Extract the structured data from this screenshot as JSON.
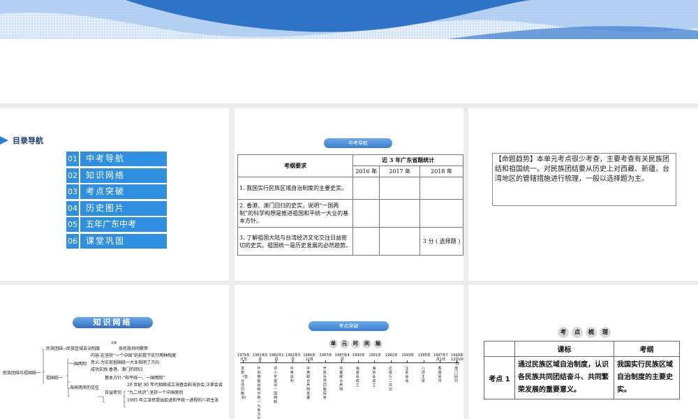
{
  "menu": {
    "header": "目录导航",
    "items": [
      {
        "num": "01",
        "label": "中考导航"
      },
      {
        "num": "02",
        "label": "知识网络"
      },
      {
        "num": "03",
        "label": "考点突破"
      },
      {
        "num": "04",
        "label": "历史图片"
      },
      {
        "num": "05",
        "label": "五年广东中考"
      },
      {
        "num": "06",
        "label": "课堂巩固"
      }
    ]
  },
  "exam_nav": {
    "pill": "中考导航",
    "col_requirement": "考纲要求",
    "col_stats": "近 3 年广东省题统计",
    "years": [
      "2016 年",
      "2017 年",
      "2018 年"
    ],
    "rows": [
      {
        "req": "1. 我国实行民族区域自治制度的主要史实。",
        "y2016": "",
        "y2017": "",
        "y2018": ""
      },
      {
        "req": "2. 香港、澳门回归的史实，说明“一国两制”的科学构想是推进祖国和平统一大业的基本方针。",
        "y2016": "",
        "y2017": "",
        "y2018": ""
      },
      {
        "req": "3. 了解祖国大陆与台湾经济文化交往日益密切的史实。祖国统一是历史发展的必然趋势。",
        "y2016": "",
        "y2017": "",
        "y2018": "3 分 ( 选择题 )"
      }
    ]
  },
  "trend": {
    "text": "【命题趋势】本单元考点很少考查，主要考查有关民族团结和祖国统一。对民族团结要从历史上对西藏、新疆、台湾地区的管辖措施进行梳理，一般以选择题为主。"
  },
  "knowledge": {
    "title": "知识网络",
    "root": "民族团结与祖国统一",
    "n_unity": "民族团结→民族区域自治制度",
    "n_unity_sub": "实施",
    "n_unity_end": "各民族共同繁荣",
    "n_reunify": "祖国统一",
    "n_1c2s": "一国两制",
    "n_1c2s_a": "内容:在坚持“一个中国”的前提下实行两种制度",
    "n_1c2s_b": "意义:为实现祖国统一大业指明了方向",
    "n_1c2s_c": "成功实践:香港、澳门的回归",
    "n_strait": "海峡两岸的交往",
    "n_strait_a": "基本方针:“和平统一、一国两制”",
    "n_closer": "日益密切",
    "n_closer_a": "20 世纪 90 年代相继成立海基会和海协会,汪辜会谈",
    "n_closer_b": "“九二共识”:坚持一个中国原则",
    "n_closer_c": "1995 年江泽民提出促进和平统一进程的八项主张"
  },
  "breakthrough": {
    "pill": "考点突破",
    "title_chars": [
      "单",
      "元",
      "时",
      "间",
      "轴"
    ],
    "years": [
      "1979年元旦",
      "1981年9月",
      "1982年1月",
      "1982年9月",
      "1984年12月",
      "1987年",
      "1987年4月",
      "1990年",
      "1991年",
      "1992年",
      "1993年",
      "1995年",
      "1997年7月1日",
      "1999年12月20日"
    ],
    "events": [
      "发表《告台湾同胞书》",
      "叶剑英提出和平统一九条方针",
      "邓小平提出一国两制",
      "中英谈判",
      "中英联合声明签署",
      "开放台湾同胞探亲",
      "中葡联合声明",
      "海基会成立",
      "海协会成立",
      "达成九二共识",
      "汪辜会谈",
      "八项主张",
      "香港回归",
      "澳门回归"
    ]
  },
  "key_points": {
    "title_chars": [
      "考",
      "点",
      "梳",
      "理"
    ],
    "col_standard": "课标",
    "col_outline": "考纲",
    "row_label": "考点 1",
    "standard": "通过民族区域自治制度，认识各民族共同团结奋斗、共同繁荣发展的重要意义。",
    "outline": "我国实行民族区域自治制度的主要史实。"
  }
}
